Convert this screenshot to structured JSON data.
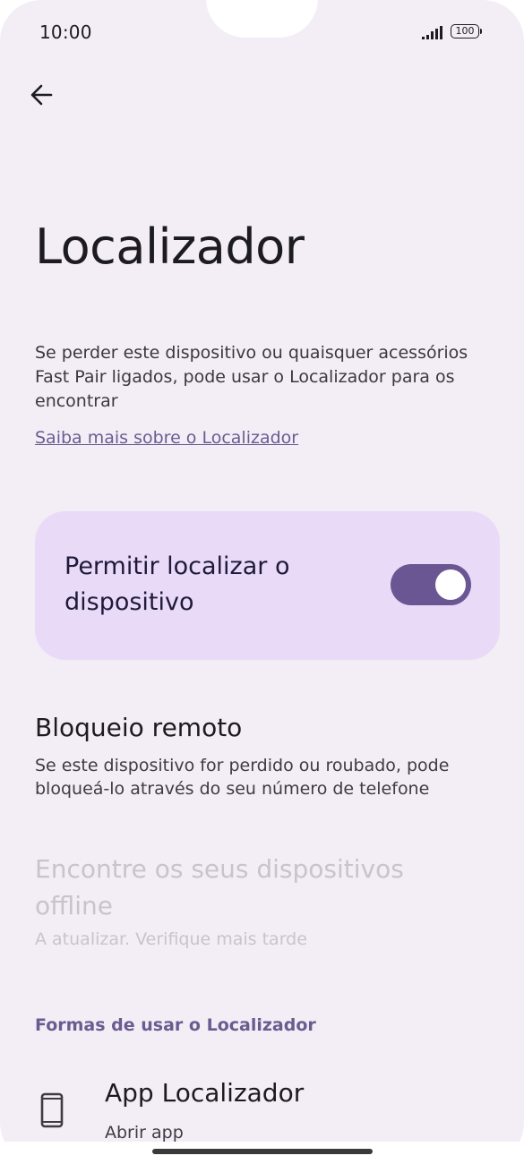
{
  "status_bar": {
    "time": "10:00",
    "battery": "100",
    "icons": [
      "signal-icon",
      "battery-icon"
    ]
  },
  "header": {
    "back_icon": "arrow-left-icon",
    "title": "Localizador"
  },
  "intro": {
    "description": "Se perder este dispositivo ou quaisquer acessórios Fast Pair ligados, pode usar o Localizador para os encontrar",
    "learn_more": "Saiba mais sobre o Localizador"
  },
  "main_toggle": {
    "label": "Permitir localizar o dispositivo",
    "state": "on"
  },
  "remote_lock": {
    "title": "Bloqueio remoto",
    "subtitle": "Se este dispositivo for perdido ou roubado, pode bloqueá-lo através do seu número de telefone"
  },
  "offline": {
    "title": "Encontre os seus dispositivos offline",
    "subtitle": "A atualizar. Verifique mais tarde"
  },
  "ways_section": {
    "header": "Formas de usar o Localizador",
    "items": [
      {
        "title": "App Localizador",
        "subtitle": "Abrir app",
        "icon": "phone-icon"
      }
    ]
  },
  "colors": {
    "background": "#f3edf5",
    "card": "#e9dbf8",
    "accent": "#6a5693",
    "disabled_text": "#c8c3cc"
  }
}
